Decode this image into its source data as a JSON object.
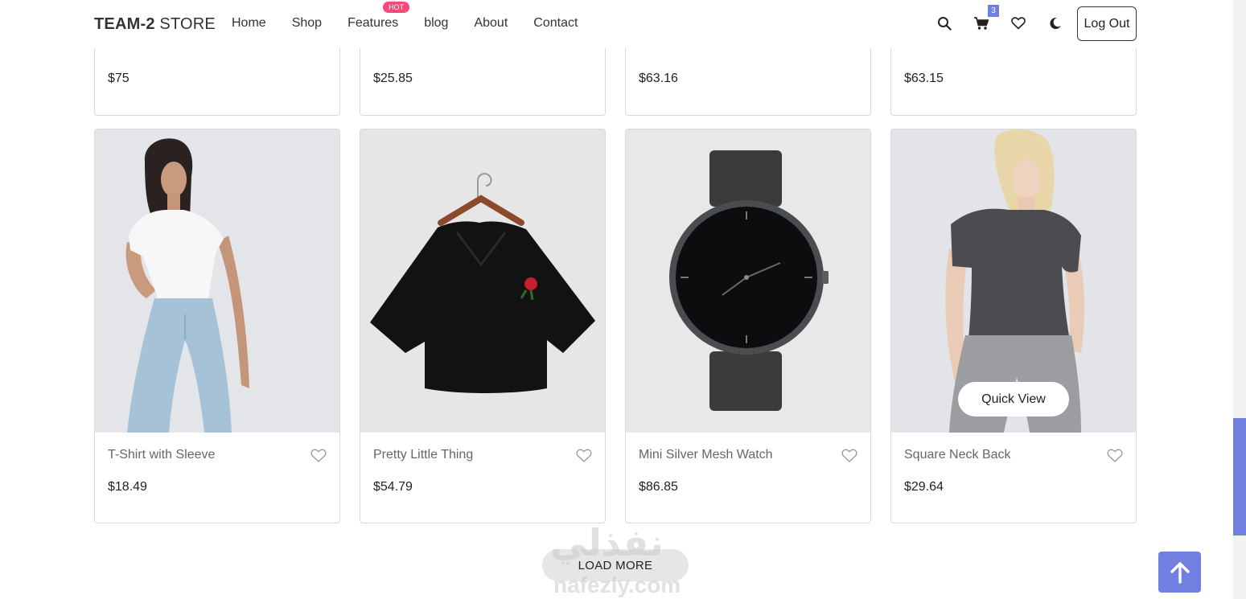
{
  "brand": {
    "bold": "TEAM-2",
    "rest": " STORE"
  },
  "nav": {
    "items": [
      {
        "label": "Home"
      },
      {
        "label": "Shop"
      },
      {
        "label": "Features",
        "badge": "HOT"
      },
      {
        "label": "blog"
      },
      {
        "label": "About"
      },
      {
        "label": "Contact"
      }
    ]
  },
  "header_icons": {
    "cart_count": "3",
    "logout_label": "Log Out"
  },
  "colors": {
    "accent": "#717fe0",
    "hot": "#f74877"
  },
  "top_row": [
    {
      "price": "$75"
    },
    {
      "price": "$25.85"
    },
    {
      "price": "$63.16"
    },
    {
      "price": "$63.15"
    }
  ],
  "products": [
    {
      "name": "T-Shirt with Sleeve",
      "price": "$18.49",
      "image": "woman-white-tshirt-jeans"
    },
    {
      "name": "Pretty Little Thing",
      "price": "$54.79",
      "image": "black-crop-top-rose"
    },
    {
      "name": "Mini Silver Mesh Watch",
      "price": "$86.85",
      "image": "black-mesh-watch"
    },
    {
      "name": "Square Neck Back",
      "price": "$29.64",
      "image": "woman-grey-tshirt"
    }
  ],
  "quick_view_label": "Quick View",
  "load_more_label": "LOAD MORE",
  "watermark": {
    "arabic": "نفذلي",
    "latin": "nafezly.com"
  }
}
